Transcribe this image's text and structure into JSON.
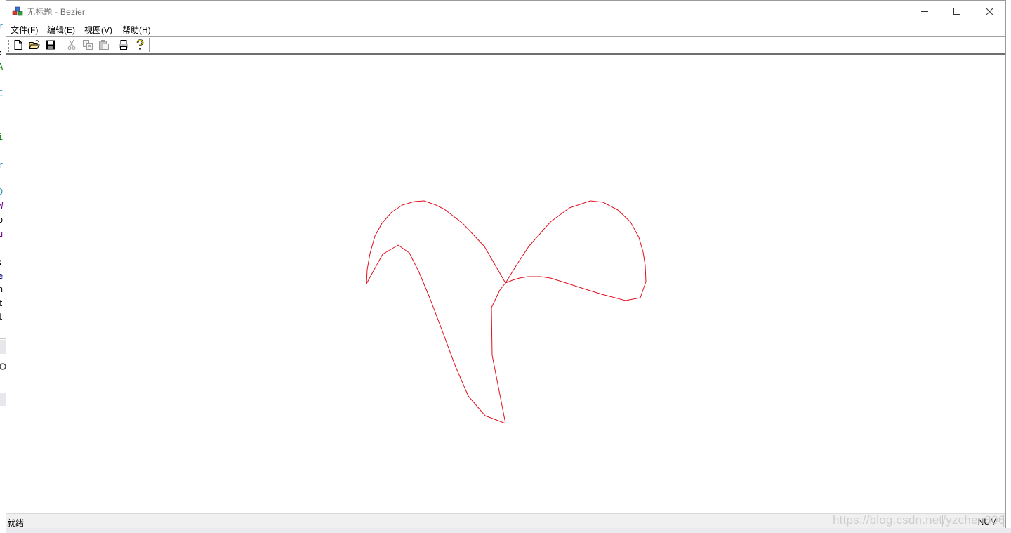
{
  "window": {
    "title": "无标题 - Bezier"
  },
  "menu": {
    "items": [
      {
        "label": "文件(F)"
      },
      {
        "label": "编辑(E)"
      },
      {
        "label": "视图(V)"
      },
      {
        "label": "帮助(H)"
      }
    ]
  },
  "toolbar": {
    "buttons": [
      {
        "icon": "new-file-icon",
        "enabled": true
      },
      {
        "icon": "open-folder-icon",
        "enabled": true
      },
      {
        "icon": "save-disk-icon",
        "enabled": true
      },
      {
        "icon": "cut-scissors-icon",
        "enabled": false
      },
      {
        "icon": "copy-icon",
        "enabled": false
      },
      {
        "icon": "paste-icon",
        "enabled": false
      },
      {
        "icon": "print-icon",
        "enabled": true
      },
      {
        "icon": "help-icon",
        "enabled": true
      }
    ]
  },
  "canvas": {
    "stroke_color": "#e0101e",
    "curves": [
      [
        [
          522,
          403
        ],
        [
          523,
          383
        ],
        [
          527,
          360
        ],
        [
          534,
          335
        ],
        [
          544,
          317
        ],
        [
          558,
          301
        ],
        [
          573,
          291
        ],
        [
          590,
          286
        ],
        [
          604,
          285
        ],
        [
          621,
          291
        ],
        [
          633,
          297
        ],
        [
          659,
          317
        ],
        [
          690,
          350
        ],
        [
          720,
          402
        ]
      ],
      [
        [
          720,
          402
        ],
        [
          736,
          376
        ],
        [
          753,
          350
        ],
        [
          784,
          315
        ],
        [
          811,
          295
        ],
        [
          841,
          285
        ],
        [
          859,
          287
        ],
        [
          880,
          298
        ],
        [
          898,
          315
        ],
        [
          910,
          337
        ],
        [
          916,
          358
        ],
        [
          919,
          377
        ],
        [
          920,
          400
        ],
        [
          912,
          423
        ],
        [
          891,
          427
        ],
        [
          857,
          418
        ],
        [
          828,
          409
        ],
        [
          797,
          399
        ],
        [
          784,
          395
        ],
        [
          770,
          393
        ],
        [
          752,
          393
        ],
        [
          740,
          395
        ],
        [
          730,
          398
        ],
        [
          720,
          402
        ]
      ],
      [
        [
          522,
          403
        ],
        [
          545,
          361
        ],
        [
          567,
          348
        ],
        [
          583,
          359
        ],
        [
          597,
          387
        ],
        [
          612,
          423
        ],
        [
          631,
          473
        ],
        [
          648,
          519
        ],
        [
          667,
          563
        ],
        [
          691,
          591
        ],
        [
          720,
          602
        ]
      ],
      [
        [
          720,
          602
        ],
        [
          701,
          505
        ],
        [
          700,
          437
        ],
        [
          712,
          412
        ],
        [
          720,
          402
        ]
      ]
    ]
  },
  "status": {
    "ready_text": "就绪",
    "num_indicator": "NUM"
  },
  "watermark": {
    "text": "https://blog.csdn.net/yzchen806"
  },
  "background_editor": {
    "fragments": [
      {
        "text": "r",
        "color": "#2b91af"
      },
      {
        "text": ":",
        "color": "#000000"
      },
      {
        "text": "A",
        "color": "#008000"
      },
      {
        "text": "C",
        "color": "#2b91af"
      },
      {
        "text": "i",
        "color": "#008000"
      },
      {
        "text": "r",
        "color": "#2b91af"
      },
      {
        "text": "D",
        "color": "#2b91af"
      },
      {
        "text": "W",
        "color": "#6f008a"
      },
      {
        "text": "o",
        "color": "#000000"
      },
      {
        "text": "u",
        "color": "#6f008a"
      },
      {
        "text": ":",
        "color": "#000000"
      },
      {
        "text": "e",
        "color": "#000080"
      },
      {
        "text": "n",
        "color": "#000000"
      },
      {
        "text": "t",
        "color": "#000000"
      },
      {
        "text": "t",
        "color": "#000000"
      }
    ]
  }
}
